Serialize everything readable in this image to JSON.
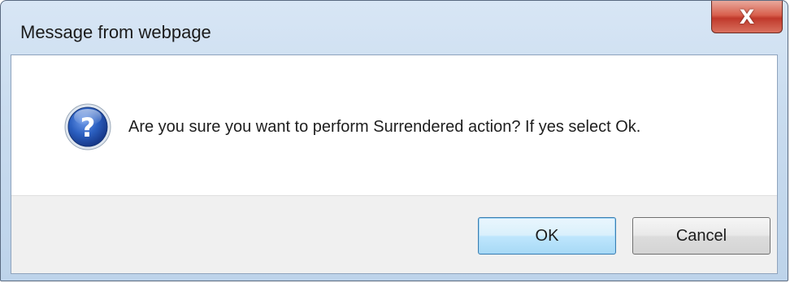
{
  "window": {
    "title": "Message from webpage",
    "close_symbol": "X"
  },
  "dialog": {
    "icon": "question-icon",
    "message": "Are you sure you want to perform Surrendered action? If yes select Ok.",
    "ok_label": "OK",
    "cancel_label": "Cancel"
  },
  "colors": {
    "title_bar": "#c9dcef",
    "close_button": "#c0392b",
    "icon_blue": "#1f4fa6",
    "footer": "#f0f0f0",
    "ok_button_border": "#3c7fb1"
  }
}
